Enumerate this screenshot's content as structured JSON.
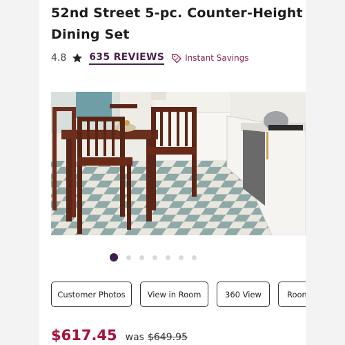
{
  "product": {
    "title": "52nd Street 5-pc. Counter-Height Dining Set",
    "rating": "4.8",
    "reviews_label": "635 REVIEWS",
    "savings_label": "Instant Savings"
  },
  "gallery": {
    "total_images": 7,
    "active_index": 0
  },
  "actions": [
    {
      "label": "Customer Photos"
    },
    {
      "label": "View in Room"
    },
    {
      "label": "360 View"
    },
    {
      "label": "Room"
    }
  ],
  "pricing": {
    "price": "$617.45",
    "was_label": "was",
    "was_price": "$649.95"
  },
  "colors": {
    "brand_purple": "#4a1f4f",
    "sale_red": "#a8123a",
    "savings_red": "#8a2342"
  }
}
